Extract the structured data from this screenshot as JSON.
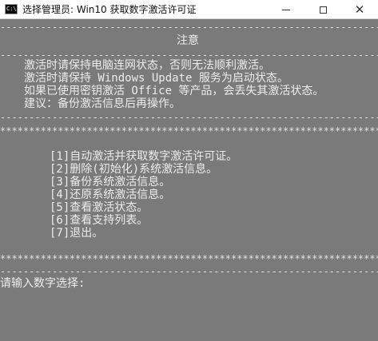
{
  "window": {
    "icon_label": "C:\\",
    "title": "选择管理员:  Win10 获取数字激活许可证",
    "controls": {
      "minimize_icon": "minimize-icon",
      "maximize_icon": "maximize-icon",
      "close_icon": "close-icon",
      "close_glyph": "✕"
    }
  },
  "console": {
    "separator_dash": "--------------------------------------------------------------------------------",
    "notice_title": "注意",
    "notice_lines": [
      "激活时请保持电脑连网状态，否则无法顺利激活。",
      "激活时请保持 Windows Update 服务为启动状态。",
      "如果已使用密钥激活 Office 等产品，会丢失其激活状态。",
      "建议：备份激活信息后再操作。"
    ],
    "separator_star": "************************************************************************************",
    "menu_items": [
      "[1]自动激活并获取数字激活许可证。",
      "[2]删除(初始化)系统激活信息。",
      "[3]备份系统激活信息。",
      "[4]还原系统激活信息。",
      "[5]查看激活状态。",
      "[6]查看支持列表。",
      "[7]退出。"
    ],
    "prompt": "请输入数字选择:"
  },
  "colors": {
    "console_bg": "#7a7a7a",
    "console_text": "#ececec",
    "titlebar_bg": "#ffffff"
  }
}
